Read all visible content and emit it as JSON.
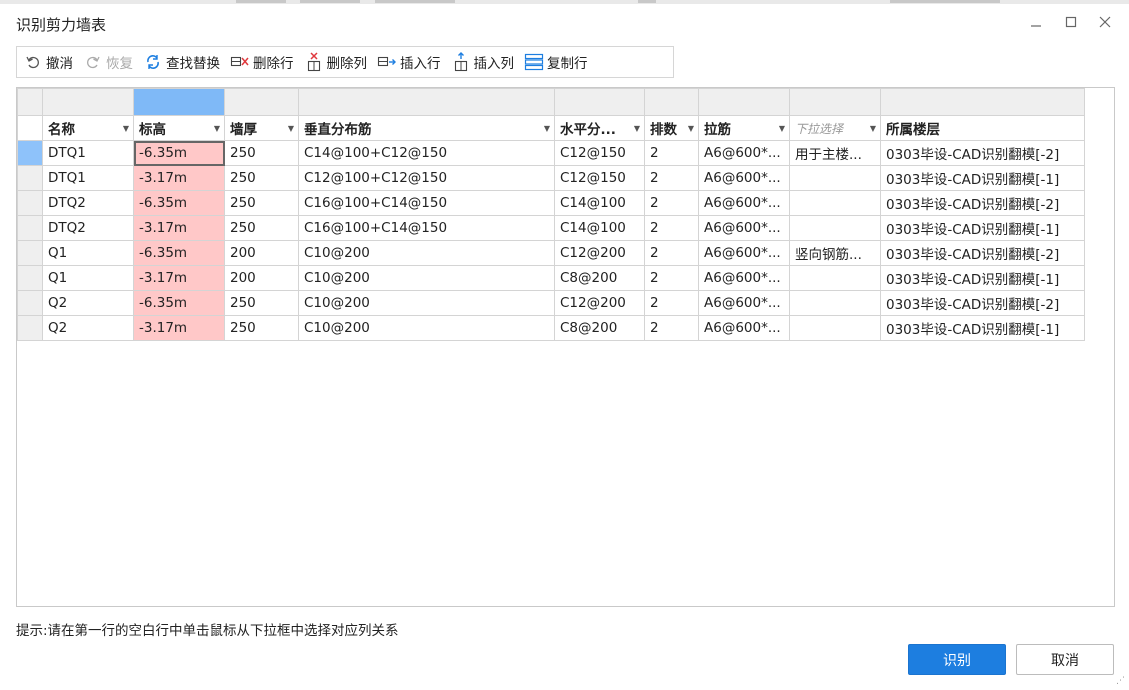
{
  "window": {
    "title": "识别剪力墙表",
    "minimize_icon": "minimize-icon",
    "maximize_icon": "maximize-icon",
    "close_icon": "close-icon"
  },
  "toolbar": {
    "undo": "撤消",
    "redo": "恢复",
    "find_replace": "查找替换",
    "delete_row": "删除行",
    "delete_col": "删除列",
    "insert_row": "插入行",
    "insert_col": "插入列",
    "copy_row": "复制行"
  },
  "table": {
    "headers": [
      "名称",
      "标高",
      "墙厚",
      "垂直分布筋",
      "水平分...",
      "排数",
      "拉筋",
      "下拉选择",
      "所属楼层"
    ],
    "rows": [
      [
        "DTQ1",
        "-6.35m",
        "250",
        "C14@100+C12@150",
        "C12@150",
        "2",
        "A6@600*...",
        "用于主楼...",
        "0303毕设-CAD识别翻模[-2]"
      ],
      [
        "DTQ1",
        "-3.17m",
        "250",
        "C12@100+C12@150",
        "C12@150",
        "2",
        "A6@600*...",
        "",
        "0303毕设-CAD识别翻模[-1]"
      ],
      [
        "DTQ2",
        "-6.35m",
        "250",
        "C16@100+C14@150",
        "C14@100",
        "2",
        "A6@600*...",
        "",
        "0303毕设-CAD识别翻模[-2]"
      ],
      [
        "DTQ2",
        "-3.17m",
        "250",
        "C16@100+C14@150",
        "C14@100",
        "2",
        "A6@600*...",
        "",
        "0303毕设-CAD识别翻模[-1]"
      ],
      [
        "Q1",
        "-6.35m",
        "200",
        "C10@200",
        "C12@200",
        "2",
        "A6@600*...",
        "竖向钢筋...",
        "0303毕设-CAD识别翻模[-2]"
      ],
      [
        "Q1",
        "-3.17m",
        "200",
        "C10@200",
        "C8@200",
        "2",
        "A6@600*...",
        "",
        "0303毕设-CAD识别翻模[-1]"
      ],
      [
        "Q2",
        "-6.35m",
        "250",
        "C10@200",
        "C12@200",
        "2",
        "A6@600*...",
        "",
        "0303毕设-CAD识别翻模[-2]"
      ],
      [
        "Q2",
        "-3.17m",
        "250",
        "C10@200",
        "C8@200",
        "2",
        "A6@600*...",
        "",
        "0303毕设-CAD识别翻模[-1]"
      ]
    ]
  },
  "hint": "提示:请在第一行的空白行中单击鼠标从下拉框中选择对应列关系",
  "buttons": {
    "ok": "识别",
    "cancel": "取消"
  },
  "colors": {
    "accent": "#1d7ee0",
    "highlight_column": "#ffc8c8",
    "selected_header": "#7fb9f7"
  }
}
